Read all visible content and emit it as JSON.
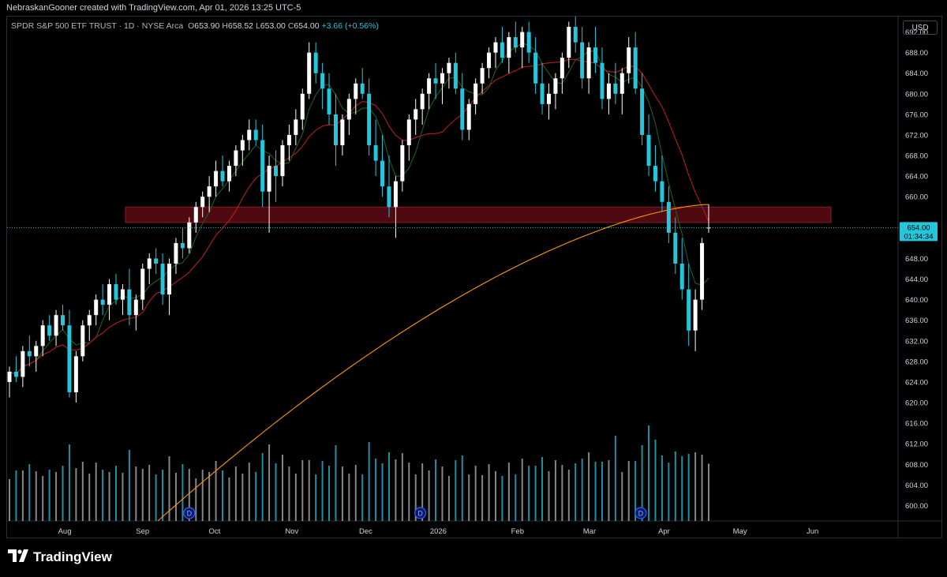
{
  "header": {
    "attribution": "NebraskanGooner created with TradingView.com, Apr 01, 2026 13:25 UTC-5"
  },
  "legend": {
    "symbol": "SPDR S&P 500 ETF TRUST · 1D · NYSE Arca",
    "open_label": "O",
    "open": "653.90",
    "high_label": "H",
    "high": "658.52",
    "low_label": "L",
    "low": "653.00",
    "close_label": "C",
    "close": "654.00",
    "change": "+3.66 (+0.56%)"
  },
  "currency_button": "USD",
  "last_price": {
    "value": "654.00",
    "countdown": "01:34:34"
  },
  "brand": "TradingView",
  "colors": {
    "up": "#ffffff",
    "down": "#26c6da",
    "ma_fast": "#1b5e20",
    "ma_slow": "#b71c1c",
    "ma_long": "#ff9800",
    "zone": "#5c0a14",
    "last_price": "#26c6da"
  },
  "chart_data": {
    "type": "candlestick",
    "interval": "1D",
    "y_axis": {
      "ylim": [
        597,
        695
      ],
      "ticks": [
        "692.00",
        "688.00",
        "684.00",
        "680.00",
        "676.00",
        "672.00",
        "668.00",
        "664.00",
        "660.00",
        "656.00",
        "652.00",
        "648.00",
        "644.00",
        "640.00",
        "636.00",
        "632.00",
        "628.00",
        "624.00",
        "620.00",
        "616.00",
        "612.00",
        "608.00",
        "604.00",
        "600.00"
      ]
    },
    "x_axis": {
      "labels": [
        "Aug",
        "Sep",
        "Oct",
        "Nov",
        "Dec",
        "2026",
        "Feb",
        "Mar",
        "Apr",
        "May",
        "Jun"
      ]
    },
    "resistance_zone": {
      "from": 655.0,
      "to": 658.0
    },
    "dividend_markers": [
      "D",
      "D",
      "D"
    ],
    "ohlc_approx": [
      [
        624,
        627,
        621,
        626
      ],
      [
        626,
        629,
        624,
        625
      ],
      [
        625,
        631,
        623,
        630
      ],
      [
        630,
        633,
        627,
        629
      ],
      [
        629,
        632,
        626,
        631
      ],
      [
        631,
        636,
        629,
        635
      ],
      [
        635,
        637,
        632,
        633
      ],
      [
        633,
        638,
        631,
        637
      ],
      [
        637,
        639,
        634,
        635
      ],
      [
        635,
        638,
        621,
        622
      ],
      [
        622,
        630,
        620,
        629
      ],
      [
        629,
        636,
        628,
        635
      ],
      [
        635,
        638,
        632,
        637
      ],
      [
        637,
        641,
        635,
        640
      ],
      [
        640,
        643,
        637,
        639
      ],
      [
        639,
        644,
        636,
        643
      ],
      [
        643,
        645,
        639,
        640
      ],
      [
        640,
        643,
        637,
        642
      ],
      [
        642,
        646,
        635,
        637
      ],
      [
        637,
        641,
        634,
        640
      ],
      [
        640,
        647,
        638,
        646
      ],
      [
        646,
        649,
        643,
        648
      ],
      [
        648,
        650,
        645,
        647
      ],
      [
        647,
        649,
        639,
        641
      ],
      [
        641,
        648,
        637,
        647
      ],
      [
        647,
        652,
        645,
        651
      ],
      [
        651,
        654,
        648,
        650
      ],
      [
        650,
        656,
        649,
        655
      ],
      [
        655,
        659,
        653,
        658
      ],
      [
        658,
        661,
        656,
        660
      ],
      [
        660,
        664,
        657,
        662
      ],
      [
        662,
        667,
        660,
        665
      ],
      [
        665,
        668,
        662,
        663
      ],
      [
        663,
        667,
        661,
        666
      ],
      [
        666,
        670,
        664,
        669
      ],
      [
        669,
        672,
        666,
        671
      ],
      [
        671,
        675,
        669,
        673
      ],
      [
        673,
        675,
        670,
        671
      ],
      [
        671,
        674,
        658,
        661
      ],
      [
        661,
        668,
        653,
        666
      ],
      [
        666,
        669,
        659,
        664
      ],
      [
        664,
        671,
        662,
        670
      ],
      [
        670,
        674,
        667,
        672
      ],
      [
        672,
        677,
        670,
        675
      ],
      [
        675,
        681,
        673,
        680
      ],
      [
        680,
        690,
        679,
        688
      ],
      [
        688,
        690,
        682,
        684
      ],
      [
        684,
        686,
        677,
        681
      ],
      [
        681,
        684,
        674,
        676
      ],
      [
        676,
        680,
        666,
        670
      ],
      [
        670,
        676,
        668,
        675
      ],
      [
        675,
        680,
        672,
        679
      ],
      [
        679,
        683,
        676,
        682
      ],
      [
        682,
        685,
        679,
        680
      ],
      [
        680,
        683,
        668,
        670
      ],
      [
        670,
        675,
        664,
        667
      ],
      [
        667,
        672,
        660,
        662
      ],
      [
        662,
        668,
        656,
        658
      ],
      [
        658,
        664,
        652,
        663
      ],
      [
        663,
        671,
        661,
        670
      ],
      [
        670,
        676,
        667,
        675
      ],
      [
        675,
        679,
        672,
        677
      ],
      [
        677,
        681,
        674,
        680
      ],
      [
        680,
        684,
        677,
        683
      ],
      [
        683,
        686,
        679,
        682
      ],
      [
        682,
        685,
        678,
        684
      ],
      [
        684,
        687,
        681,
        686
      ],
      [
        686,
        688,
        680,
        681
      ],
      [
        681,
        684,
        671,
        673
      ],
      [
        673,
        679,
        671,
        678
      ],
      [
        678,
        683,
        676,
        682
      ],
      [
        682,
        686,
        680,
        685
      ],
      [
        685,
        689,
        683,
        688
      ],
      [
        688,
        691,
        685,
        690
      ],
      [
        690,
        693,
        686,
        687
      ],
      [
        687,
        692,
        684,
        691
      ],
      [
        691,
        694,
        688,
        689
      ],
      [
        689,
        693,
        685,
        692
      ],
      [
        692,
        694,
        686,
        688
      ],
      [
        688,
        691,
        680,
        682
      ],
      [
        682,
        686,
        676,
        678
      ],
      [
        678,
        682,
        675,
        680
      ],
      [
        680,
        684,
        677,
        683
      ],
      [
        683,
        688,
        680,
        687
      ],
      [
        687,
        694,
        685,
        693
      ],
      [
        693,
        695,
        688,
        690
      ],
      [
        690,
        693,
        681,
        683
      ],
      [
        683,
        690,
        680,
        689
      ],
      [
        689,
        693,
        684,
        686
      ],
      [
        686,
        689,
        677,
        679
      ],
      [
        679,
        684,
        676,
        682
      ],
      [
        682,
        686,
        678,
        680
      ],
      [
        680,
        685,
        676,
        684
      ],
      [
        684,
        691,
        682,
        689
      ],
      [
        689,
        692,
        680,
        681
      ],
      [
        681,
        684,
        670,
        672
      ],
      [
        672,
        676,
        664,
        666
      ],
      [
        666,
        670,
        661,
        663
      ],
      [
        663,
        668,
        657,
        659
      ],
      [
        659,
        662,
        651,
        653
      ],
      [
        653,
        656,
        645,
        647
      ],
      [
        647,
        652,
        640,
        642
      ],
      [
        642,
        647,
        631,
        634
      ],
      [
        634,
        642,
        630,
        640
      ],
      [
        640,
        652,
        638,
        651
      ],
      [
        653.9,
        658.52,
        653,
        654
      ]
    ]
  }
}
